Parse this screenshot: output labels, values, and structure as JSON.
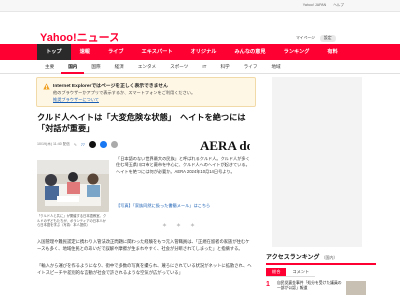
{
  "topbar": {
    "links": [
      "Yahoo! JAPAN",
      "ヘルプ"
    ]
  },
  "header": {
    "logo_text": "Yahoo!ニュース",
    "util": [
      "マイページ",
      "設定"
    ]
  },
  "gnav": {
    "items": [
      "トップ",
      "速報",
      "ライブ",
      "エキスパート",
      "オリジナル",
      "みんなの意見",
      "ランキング",
      "有料"
    ],
    "active": 0
  },
  "subnav": {
    "items": [
      "主要",
      "国内",
      "国際",
      "経済",
      "エンタメ",
      "スポーツ",
      "IT",
      "科学",
      "ライフ",
      "地域"
    ],
    "active": 1
  },
  "notice": {
    "title": "Internet Explorerではページを正しく表示できません",
    "body": "他のブラウザーかアプリで表示するか、スマートフォンをご利用ください。",
    "link": "推奨ブラウザーについて"
  },
  "article": {
    "title": "クルド人ヘイトは「大変危険な状態」　ヘイトを絶つには「対話が重要」",
    "date": "10/19(木) 11:40 配信",
    "comments": "77",
    "publisher_logo": "AERA dot.",
    "photo_caption": "「クルド人と共に」が開催する日本語教室。クルドの子どもたちが、ボランティアの日本人から日本語を学ぶ（写真：本人提供）",
    "lead": "「日本語のない世界最大の民族」と呼ばれるクルド人。クルド人が多く住む埼玉県川口市と蕨市を中心に、クルド人へのヘイトが起きている。ヘイトを絶つには何が必要か。AERA 2024年10月14日号より。",
    "photo_link": "【写真】「家族同然に扱った書簡メール」はこちら",
    "separator": "＊＊＊",
    "p1": "入国管理や難民認定に携わり入管法改正問題に関わった経験をもつ元入管職員は、「正規在留者の家族が住むケースも多く、地域住民とのあいだで誤解や摩擦が生まれやすく、社会が分断されてしまった」と指摘する。",
    "p2": "「輸入から運びを作るようになり、街中で多数の写真を撮られ、蔑ろにされている状況がネットに拡散され、ヘイトスピーチや差別的な言動が社会で許されるような空気が広がっている」"
  },
  "ranking": {
    "title": "アクセスランキング",
    "subtitle": "（国内）",
    "tabs": [
      "総合",
      "コメント"
    ],
    "items": [
      {
        "rank": "1",
        "text": "自民党裏金事件「処分を受けた議員の一部が公認」報道"
      }
    ]
  },
  "colors": {
    "brand": "#ff0033",
    "link": "#1a5fb4",
    "notice_bg": "#fff7e6"
  }
}
